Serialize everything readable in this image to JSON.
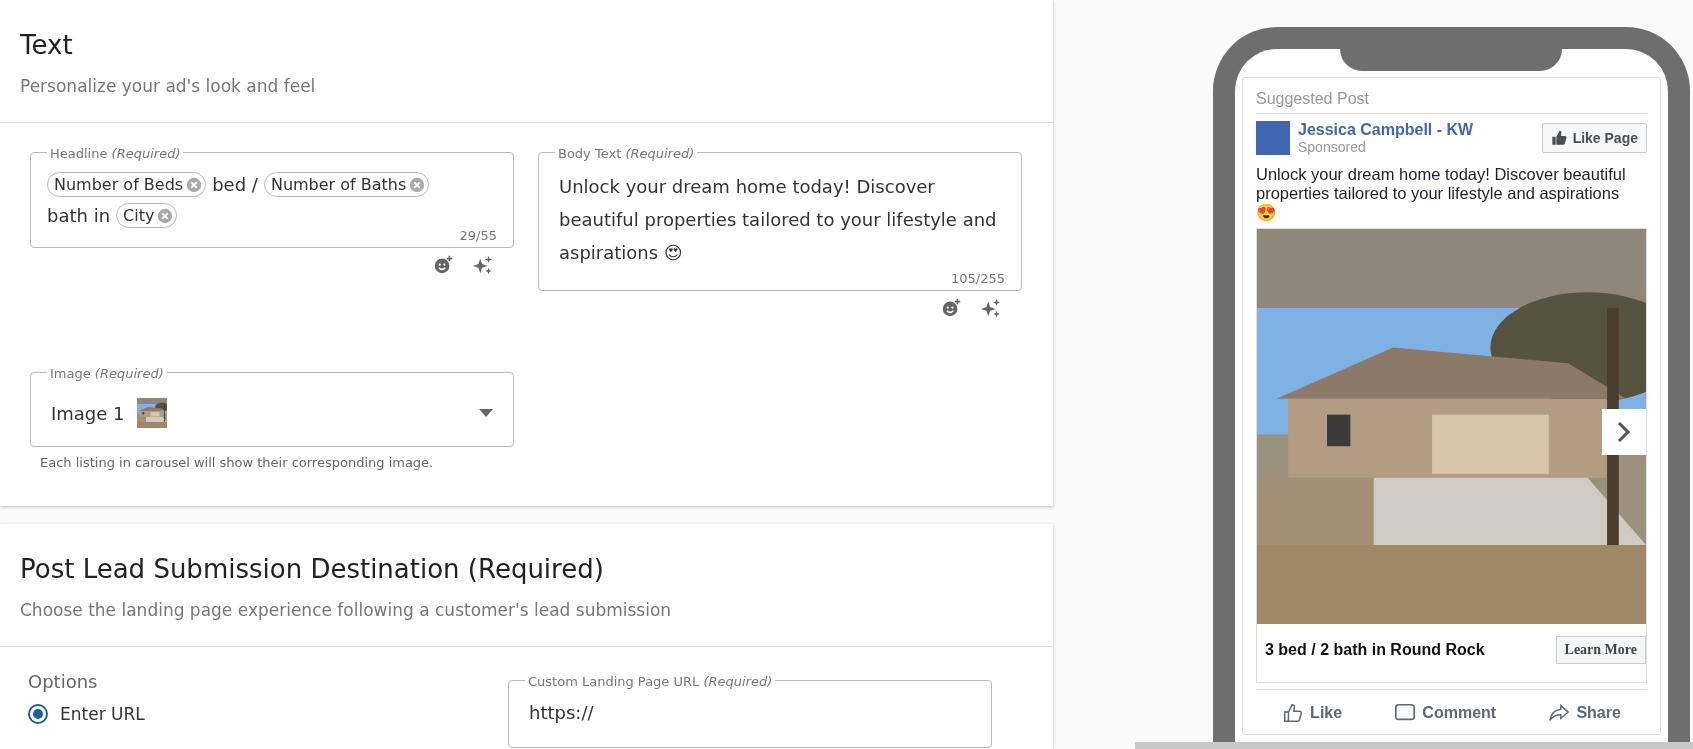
{
  "text_card": {
    "title": "Text",
    "subtitle": "Personalize your ad's look and feel",
    "headline": {
      "label": "Headline *(Required)*",
      "segments": [
        {
          "kind": "chip",
          "text": "Number of Beds"
        },
        {
          "kind": "text",
          "text": "bed /"
        },
        {
          "kind": "chip",
          "text": "Number of Baths"
        },
        {
          "kind": "text",
          "text": "bath in"
        },
        {
          "kind": "chip",
          "text": "City"
        }
      ],
      "counter": "29/55"
    },
    "body": {
      "label": "Body Text *(Required)*",
      "value": "Unlock your dream home today! Discover beautiful properties tailored to your lifestyle and aspirations 😍",
      "counter": "105/255"
    },
    "image": {
      "label": "Image *(Required)*",
      "value": "Image 1",
      "helper": "Each listing in carousel will show their corresponding image."
    }
  },
  "destination_card": {
    "title": "Post Lead Submission Destination (Required)",
    "subtitle": "Choose the landing page experience following a customer's lead submission",
    "options_label": "Options",
    "options": [
      {
        "label": "Enter URL",
        "selected": true
      }
    ],
    "url": {
      "label": "Custom Landing Page URL *(Required)*",
      "value": "https://"
    }
  },
  "preview": {
    "header": "Suggested Post",
    "page_name": "Jessica Campbell - KW",
    "sponsored": "Sponsored",
    "like_page": "Like Page",
    "body": "Unlock your dream home today! Discover beautiful properties tailored to your lifestyle and aspirations 😍",
    "caption": "3 bed / 2 bath in Round Rock",
    "cta": "Learn More",
    "actions": [
      {
        "kind": "like",
        "label": "Like"
      },
      {
        "kind": "comment",
        "label": "Comment"
      },
      {
        "kind": "share",
        "label": "Share"
      }
    ]
  }
}
